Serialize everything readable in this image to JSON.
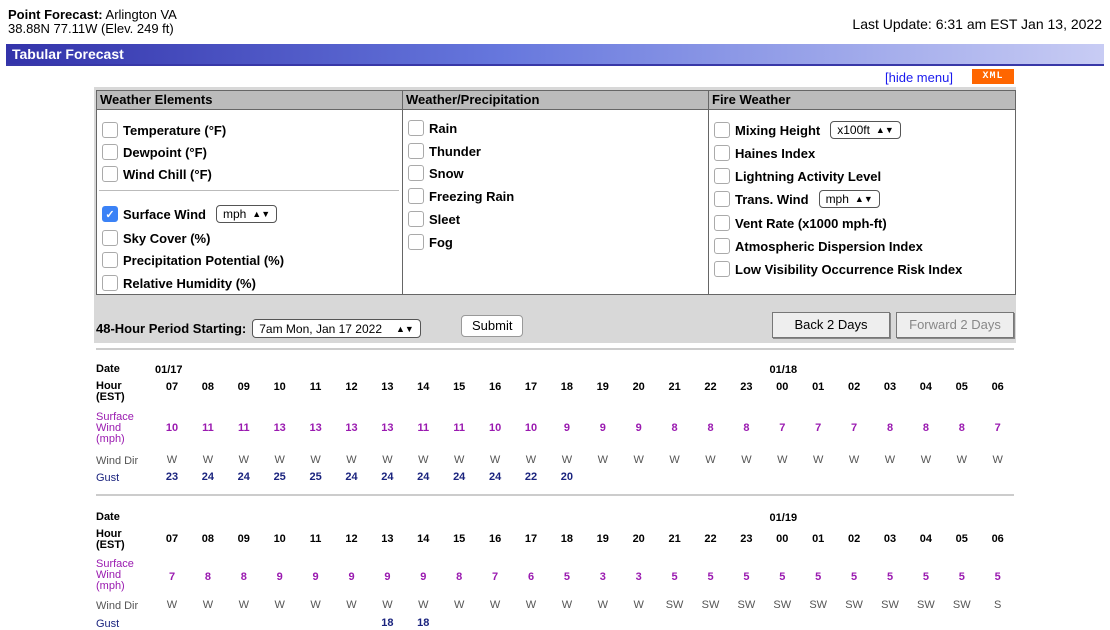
{
  "header": {
    "title_label": "Point Forecast:",
    "location": "Arlington VA",
    "coords": "38.88N 77.11W (Elev. 249 ft)",
    "last_update": "Last Update: 6:31 am EST Jan 13, 2022"
  },
  "bar": {
    "title": "Tabular Forecast"
  },
  "menu": {
    "hide_link": "[hide menu]",
    "xml_badge": "XML",
    "col1": {
      "heading": "Weather Elements",
      "items": [
        {
          "label": "Temperature (°F)",
          "checked": false
        },
        {
          "label": "Dewpoint (°F)",
          "checked": false
        },
        {
          "label": "Wind Chill (°F)",
          "checked": false
        },
        {
          "label": "Surface Wind",
          "checked": true,
          "unit": "mph"
        },
        {
          "label": "Sky Cover (%)",
          "checked": false
        },
        {
          "label": "Precipitation Potential (%)",
          "checked": false
        },
        {
          "label": "Relative Humidity (%)",
          "checked": false
        }
      ]
    },
    "col2": {
      "heading": "Weather/Precipitation",
      "items": [
        {
          "label": "Rain"
        },
        {
          "label": "Thunder"
        },
        {
          "label": "Snow"
        },
        {
          "label": "Freezing Rain"
        },
        {
          "label": "Sleet"
        },
        {
          "label": "Fog"
        }
      ]
    },
    "col3": {
      "heading": "Fire Weather",
      "items": [
        {
          "label": "Mixing Height",
          "unit": "x100ft"
        },
        {
          "label": "Haines Index"
        },
        {
          "label": "Lightning Activity Level"
        },
        {
          "label": "Trans. Wind",
          "unit": "mph"
        },
        {
          "label": "Vent Rate (x1000 mph-ft)"
        },
        {
          "label": "Atmospheric Dispersion Index"
        },
        {
          "label": "Low Visibility Occurrence Risk Index"
        }
      ]
    },
    "period_label": "48-Hour Period Starting:",
    "period_value": "7am Mon, Jan 17 2022",
    "submit": "Submit",
    "back": "Back 2 Days",
    "forward": "Forward 2 Days"
  },
  "tables": [
    {
      "date_label": "Date",
      "hour_label": "Hour",
      "hour_sub": "(EST)",
      "wind_label": [
        "Surface",
        "Wind",
        "(mph)"
      ],
      "dir_label": "Wind Dir",
      "gust_label": "Gust",
      "date1": "01/17",
      "date2": "01/18",
      "hours": [
        "07",
        "08",
        "09",
        "10",
        "11",
        "12",
        "13",
        "14",
        "15",
        "16",
        "17",
        "18",
        "19",
        "20",
        "21",
        "22",
        "23",
        "00",
        "01",
        "02",
        "03",
        "04",
        "05",
        "06"
      ],
      "wind": [
        "10",
        "11",
        "11",
        "13",
        "13",
        "13",
        "13",
        "11",
        "11",
        "10",
        "10",
        "9",
        "9",
        "9",
        "8",
        "8",
        "8",
        "7",
        "7",
        "7",
        "8",
        "8",
        "8",
        "7"
      ],
      "dir": [
        "W",
        "W",
        "W",
        "W",
        "W",
        "W",
        "W",
        "W",
        "W",
        "W",
        "W",
        "W",
        "W",
        "W",
        "W",
        "W",
        "W",
        "W",
        "W",
        "W",
        "W",
        "W",
        "W",
        "W"
      ],
      "gust": [
        "23",
        "24",
        "24",
        "25",
        "25",
        "24",
        "24",
        "24",
        "24",
        "24",
        "22",
        "20",
        "",
        "",
        "",
        "",
        "",
        "",
        "",
        "",
        "",
        "",
        "",
        ""
      ]
    },
    {
      "date_label": "Date",
      "hour_label": "Hour",
      "hour_sub": "(EST)",
      "wind_label": [
        "Surface",
        "Wind",
        "(mph)"
      ],
      "dir_label": "Wind Dir",
      "gust_label": "Gust",
      "date1": "",
      "date2": "01/19",
      "hours": [
        "07",
        "08",
        "09",
        "10",
        "11",
        "12",
        "13",
        "14",
        "15",
        "16",
        "17",
        "18",
        "19",
        "20",
        "21",
        "22",
        "23",
        "00",
        "01",
        "02",
        "03",
        "04",
        "05",
        "06"
      ],
      "wind": [
        "7",
        "8",
        "8",
        "9",
        "9",
        "9",
        "9",
        "9",
        "8",
        "7",
        "6",
        "5",
        "3",
        "3",
        "5",
        "5",
        "5",
        "5",
        "5",
        "5",
        "5",
        "5",
        "5",
        "5"
      ],
      "dir": [
        "W",
        "W",
        "W",
        "W",
        "W",
        "W",
        "W",
        "W",
        "W",
        "W",
        "W",
        "W",
        "W",
        "W",
        "SW",
        "SW",
        "SW",
        "SW",
        "SW",
        "SW",
        "SW",
        "SW",
        "SW",
        "S"
      ],
      "gust": [
        "",
        "",
        "",
        "",
        "",
        "",
        "18",
        "18",
        "",
        "",
        "",
        "",
        "",
        "",
        "",
        "",
        "",
        "",
        "",
        "",
        "",
        "",
        "",
        ""
      ]
    }
  ]
}
